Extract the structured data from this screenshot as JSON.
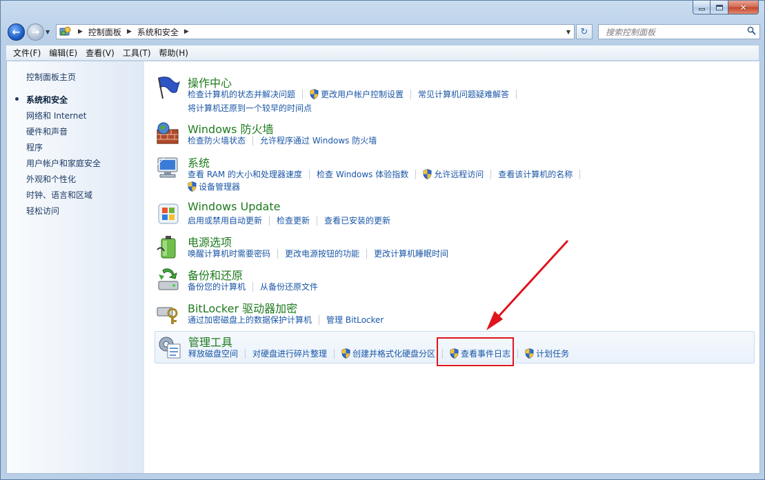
{
  "window": {
    "controls": {
      "minimize": "",
      "maximize": "",
      "close": "✕"
    }
  },
  "address_bar": {
    "crumbs": [
      "控制面板",
      "系统和安全"
    ]
  },
  "search": {
    "placeholder": "搜索控制面板"
  },
  "menu": [
    "文件(F)",
    "编辑(E)",
    "查看(V)",
    "工具(T)",
    "帮助(H)"
  ],
  "sidebar": {
    "home": "控制面板主页",
    "items": [
      "系统和安全",
      "网络和 Internet",
      "硬件和声音",
      "程序",
      "用户帐户和家庭安全",
      "外观和个性化",
      "时钟、语言和区域",
      "轻松访问"
    ],
    "current_index": 0
  },
  "categories": [
    {
      "title": "操作中心",
      "icon": "flag-icon",
      "links_row1": [
        {
          "text": "检查计算机的状态并解决问题",
          "shield": false
        },
        {
          "text": "更改用户帐户控制设置",
          "shield": true
        },
        {
          "text": "常见计算机问题疑难解答",
          "shield": false
        }
      ],
      "links_row2": [
        {
          "text": "将计算机还原到一个较早的时间点",
          "shield": false
        }
      ]
    },
    {
      "title": "Windows 防火墙",
      "icon": "firewall-icon",
      "links_row1": [
        {
          "text": "检查防火墙状态",
          "shield": false
        },
        {
          "text": "允许程序通过 Windows 防火墙",
          "shield": false
        }
      ]
    },
    {
      "title": "系统",
      "icon": "computer-icon",
      "links_row1": [
        {
          "text": "查看 RAM 的大小和处理器速度",
          "shield": false
        },
        {
          "text": "检查 Windows 体验指数",
          "shield": false
        },
        {
          "text": "允许远程访问",
          "shield": true
        },
        {
          "text": "查看该计算机的名称",
          "shield": false
        }
      ],
      "links_row2": [
        {
          "text": "设备管理器",
          "shield": true
        }
      ]
    },
    {
      "title": "Windows Update",
      "icon": "windows-update-icon",
      "links_row1": [
        {
          "text": "启用或禁用自动更新",
          "shield": false
        },
        {
          "text": "检查更新",
          "shield": false
        },
        {
          "text": "查看已安装的更新",
          "shield": false
        }
      ]
    },
    {
      "title": "电源选项",
      "icon": "battery-icon",
      "links_row1": [
        {
          "text": "唤醒计算机时需要密码",
          "shield": false
        },
        {
          "text": "更改电源按钮的功能",
          "shield": false
        },
        {
          "text": "更改计算机睡眠时间",
          "shield": false
        }
      ]
    },
    {
      "title": "备份和还原",
      "icon": "backup-icon",
      "links_row1": [
        {
          "text": "备份您的计算机",
          "shield": false
        },
        {
          "text": "从备份还原文件",
          "shield": false
        }
      ]
    },
    {
      "title": "BitLocker 驱动器加密",
      "icon": "key-icon",
      "links_row1": [
        {
          "text": "通过加密磁盘上的数据保护计算机",
          "shield": false
        },
        {
          "text": "管理 BitLocker",
          "shield": false
        }
      ]
    },
    {
      "title": "管理工具",
      "icon": "admin-tools-icon",
      "links_row1": [
        {
          "text": "释放磁盘空间",
          "shield": false
        },
        {
          "text": "对硬盘进行碎片整理",
          "shield": false
        },
        {
          "text": "创建并格式化硬盘分区",
          "shield": true
        },
        {
          "text": "查看事件日志",
          "shield": true
        },
        {
          "text": "计划任务",
          "shield": true
        }
      ]
    }
  ],
  "colors": {
    "link": "#1a56a6",
    "category_title": "#1e7a1e",
    "annotation": "#e0141e"
  }
}
